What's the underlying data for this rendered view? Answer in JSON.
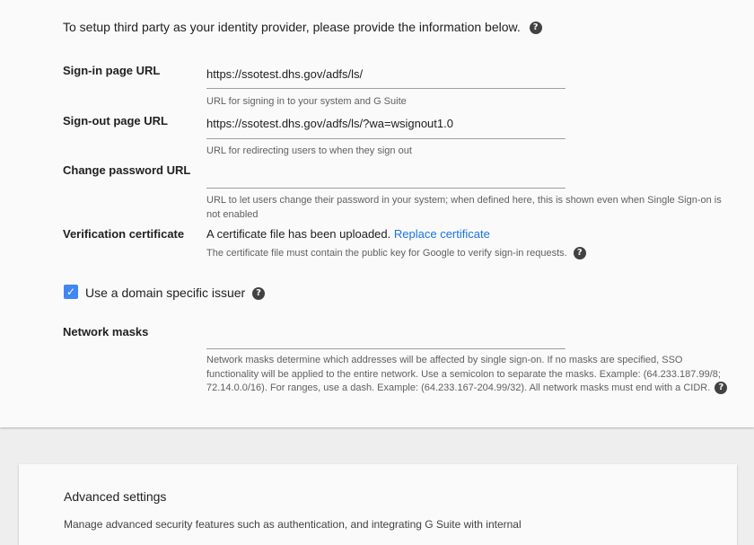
{
  "intro": {
    "text": "To setup third party as your identity provider, please provide the information below.",
    "help_icon": "question-circle-icon"
  },
  "fields": {
    "signin": {
      "label": "Sign-in page URL",
      "value": "https://ssotest.dhs.gov/adfs/ls/",
      "hint": "URL for signing in to your system and G Suite"
    },
    "signout": {
      "label": "Sign-out page URL",
      "value": "https://ssotest.dhs.gov/adfs/ls/?wa=wsignout1.0",
      "hint": "URL for redirecting users to when they sign out"
    },
    "change_password": {
      "label": "Change password URL",
      "value": "",
      "hint": "URL to let users change their password in your system; when defined here, this is shown even when Single Sign-on is not enabled"
    },
    "certificate": {
      "label": "Verification certificate",
      "status": "A certificate file has been uploaded.",
      "link": "Replace certificate",
      "hint": "The certificate file must contain the public key for Google to verify sign-in requests."
    }
  },
  "domain_issuer": {
    "label": "Use a domain specific issuer",
    "checked": true
  },
  "network_masks": {
    "label": "Network masks",
    "value": "",
    "hint": "Network masks determine which addresses will be affected by single sign-on. If no masks are specified, SSO functionality will be applied to the entire network. Use a semicolon to separate the masks. Example: (64.233.187.99/8; 72.14.0.0/16). For ranges, use a dash. Example: (64.233.167-204.99/32). All network masks must end with a CIDR."
  },
  "advanced": {
    "title": "Advanced settings",
    "description": "Manage advanced security features such as authentication, and integrating G Suite with internal"
  },
  "colors": {
    "accent": "#4285f4",
    "link": "#1a73e8",
    "background": "#eeeeee",
    "card": "#fafafa"
  }
}
